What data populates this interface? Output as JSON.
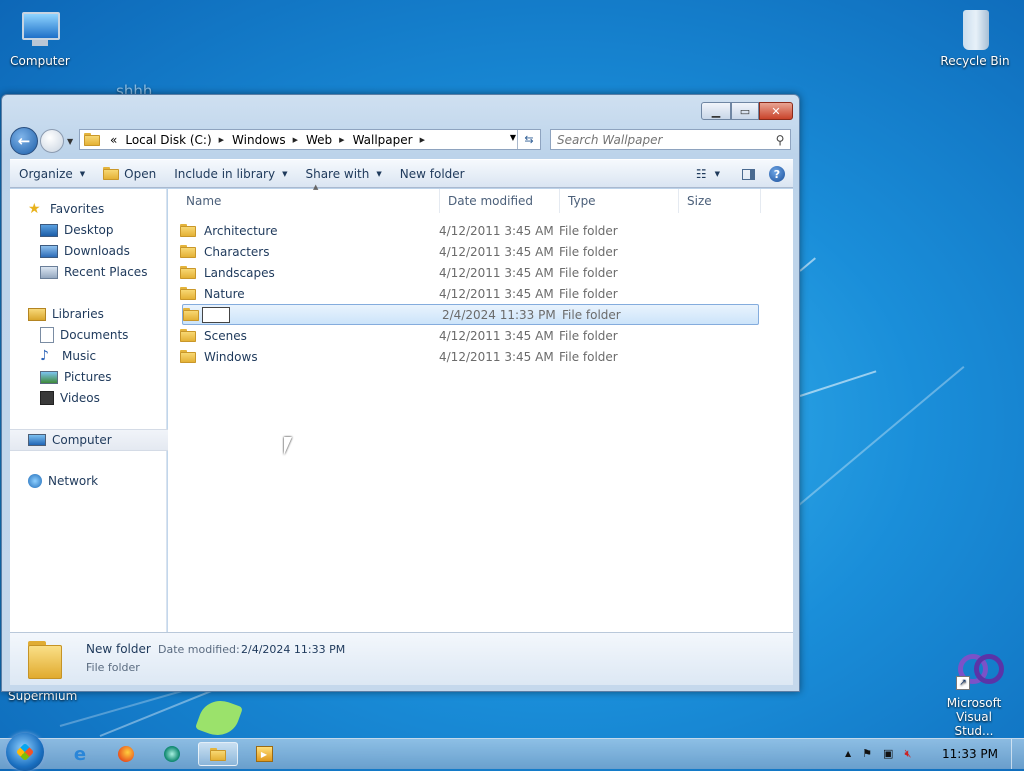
{
  "desktop": {
    "icons": [
      {
        "label": "Computer"
      },
      {
        "label": "Recycle Bin"
      },
      {
        "label": "Microsoft Visual Stud..."
      }
    ],
    "stray_text_top": "shhh",
    "stray_text_bottom": "Supermium"
  },
  "window": {
    "breadcrumb": {
      "overflow": "«",
      "items": [
        "Local Disk (C:)",
        "Windows",
        "Web",
        "Wallpaper"
      ]
    },
    "search": {
      "placeholder": "Search Wallpaper"
    },
    "toolbar": {
      "organize": "Organize",
      "open": "Open",
      "include_in_library": "Include in library",
      "share_with": "Share with",
      "new_folder": "New folder"
    },
    "nav": {
      "favorites": "Favorites",
      "desktop": "Desktop",
      "downloads": "Downloads",
      "recent_places": "Recent Places",
      "libraries": "Libraries",
      "documents": "Documents",
      "music": "Music",
      "pictures": "Pictures",
      "videos": "Videos",
      "computer": "Computer",
      "network": "Network"
    },
    "columns": {
      "name": "Name",
      "date": "Date modified",
      "type": "Type",
      "size": "Size"
    },
    "files": [
      {
        "name": "Architecture",
        "date": "4/12/2011 3:45 AM",
        "type": "File folder"
      },
      {
        "name": "Characters",
        "date": "4/12/2011 3:45 AM",
        "type": "File folder"
      },
      {
        "name": "Landscapes",
        "date": "4/12/2011 3:45 AM",
        "type": "File folder"
      },
      {
        "name": "Nature",
        "date": "4/12/2011 3:45 AM",
        "type": "File folder"
      },
      {
        "name": "",
        "date": "2/4/2024 11:33 PM",
        "type": "File folder",
        "renaming": true
      },
      {
        "name": "Scenes",
        "date": "4/12/2011 3:45 AM",
        "type": "File folder"
      },
      {
        "name": "Windows",
        "date": "4/12/2011 3:45 AM",
        "type": "File folder"
      }
    ],
    "details": {
      "name": "New folder",
      "date_label": "Date modified:",
      "date_value": "2/4/2024 11:33 PM",
      "type": "File folder"
    }
  },
  "taskbar": {
    "clock": "11:33 PM"
  },
  "colors": {
    "desktop": "#1a8ed9",
    "selection": "#cce4fa",
    "close_button": "#c9432a"
  }
}
